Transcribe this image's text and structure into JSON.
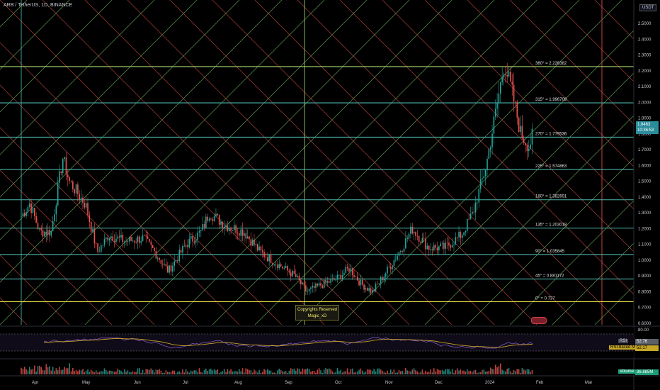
{
  "header": {
    "title": "ARB / TetherUS, 1D, BINANCE",
    "currency": "USDT"
  },
  "price_badge": {
    "value": "1.8463",
    "countdown": "10:36:53"
  },
  "copyright": {
    "line1": "Copyrights Reserved",
    "line2": "Magic_xD"
  },
  "rsi": {
    "tag": "RSI",
    "value": "52.76",
    "ma_tag": "RSI-based MA",
    "ma_value": "52.17"
  },
  "volume": {
    "tag": "Volume",
    "value": "36.885M"
  },
  "colors": {
    "background": "#000000",
    "up": "#26a69a",
    "down": "#ef5350",
    "gann_horizontal": "#4db6ac",
    "gann_zero": "#f5e74a",
    "gann_top": "#a5d66b",
    "diag_green": "#7cc96a",
    "diag_red": "#e0524e",
    "rsi_line": "#7e57c2",
    "rsi_ma": "#c9a227"
  },
  "chart_data": {
    "type": "candlestick",
    "title": "ARB / TetherUS, 1D, BINANCE",
    "y_axis": {
      "ticks": [
        "2.5000",
        "2.4000",
        "2.3000",
        "2.2000",
        "2.1000",
        "2.0000",
        "1.9000",
        "1.8000",
        "1.7000",
        "1.6000",
        "1.5000",
        "1.4000",
        "1.3000",
        "1.2000",
        "1.1000",
        "1.0000",
        "0.9000",
        "0.8000",
        "0.7000",
        "0.6000"
      ],
      "ylim": [
        0.6,
        2.55
      ]
    },
    "rsi_axis": {
      "top_tick": "80.00"
    },
    "x_axis": {
      "months": [
        "Apr",
        "May",
        "Jun",
        "Jul",
        "Aug",
        "Sep",
        "Oct",
        "Nov",
        "Dec",
        "2024",
        "Feb",
        "Mar"
      ]
    },
    "gann_levels": [
      {
        "label": "360° = 2.226382",
        "value": 2.226382
      },
      {
        "label": "315° = 1.996709",
        "value": 1.996709
      },
      {
        "label": "270° = 1.779536",
        "value": 1.779536
      },
      {
        "label": "225° = 1.574863",
        "value": 1.574863
      },
      {
        "label": "180° = 1.382691",
        "value": 1.382691
      },
      {
        "label": "135° = 1.203018",
        "value": 1.203018
      },
      {
        "label": "90° = 1.035845",
        "value": 1.035845
      },
      {
        "label": "45° = 0.881172",
        "value": 0.881172
      },
      {
        "label": "0° = 0.737",
        "value": 0.737
      }
    ],
    "close_path": [
      [
        "2023-03-23",
        1.28
      ],
      [
        "2023-03-28",
        1.36
      ],
      [
        "2023-04-03",
        1.18
      ],
      [
        "2023-04-10",
        1.18
      ],
      [
        "2023-04-17",
        1.65
      ],
      [
        "2023-04-21",
        1.5
      ],
      [
        "2023-05-01",
        1.35
      ],
      [
        "2023-05-08",
        1.05
      ],
      [
        "2023-05-15",
        1.16
      ],
      [
        "2023-05-25",
        1.12
      ],
      [
        "2023-06-05",
        1.14
      ],
      [
        "2023-06-12",
        1.05
      ],
      [
        "2023-06-20",
        0.93
      ],
      [
        "2023-07-01",
        1.1
      ],
      [
        "2023-07-10",
        1.18
      ],
      [
        "2023-07-15",
        1.3
      ],
      [
        "2023-07-25",
        1.22
      ],
      [
        "2023-08-05",
        1.18
      ],
      [
        "2023-08-15",
        1.05
      ],
      [
        "2023-08-25",
        0.98
      ],
      [
        "2023-09-05",
        0.9
      ],
      [
        "2023-09-12",
        0.8
      ],
      [
        "2023-09-20",
        0.84
      ],
      [
        "2023-09-30",
        0.88
      ],
      [
        "2023-10-08",
        0.95
      ],
      [
        "2023-10-15",
        0.85
      ],
      [
        "2023-10-22",
        0.8
      ],
      [
        "2023-11-01",
        0.95
      ],
      [
        "2023-11-10",
        1.1
      ],
      [
        "2023-11-15",
        1.2
      ],
      [
        "2023-11-25",
        1.08
      ],
      [
        "2023-12-05",
        1.08
      ],
      [
        "2023-12-15",
        1.16
      ],
      [
        "2023-12-22",
        1.3
      ],
      [
        "2023-12-30",
        1.6
      ],
      [
        "2024-01-05",
        1.95
      ],
      [
        "2024-01-10",
        2.25
      ],
      [
        "2024-01-15",
        2.05
      ],
      [
        "2024-01-20",
        1.8
      ],
      [
        "2024-01-25",
        1.72
      ],
      [
        "2024-01-29",
        1.85
      ]
    ]
  }
}
